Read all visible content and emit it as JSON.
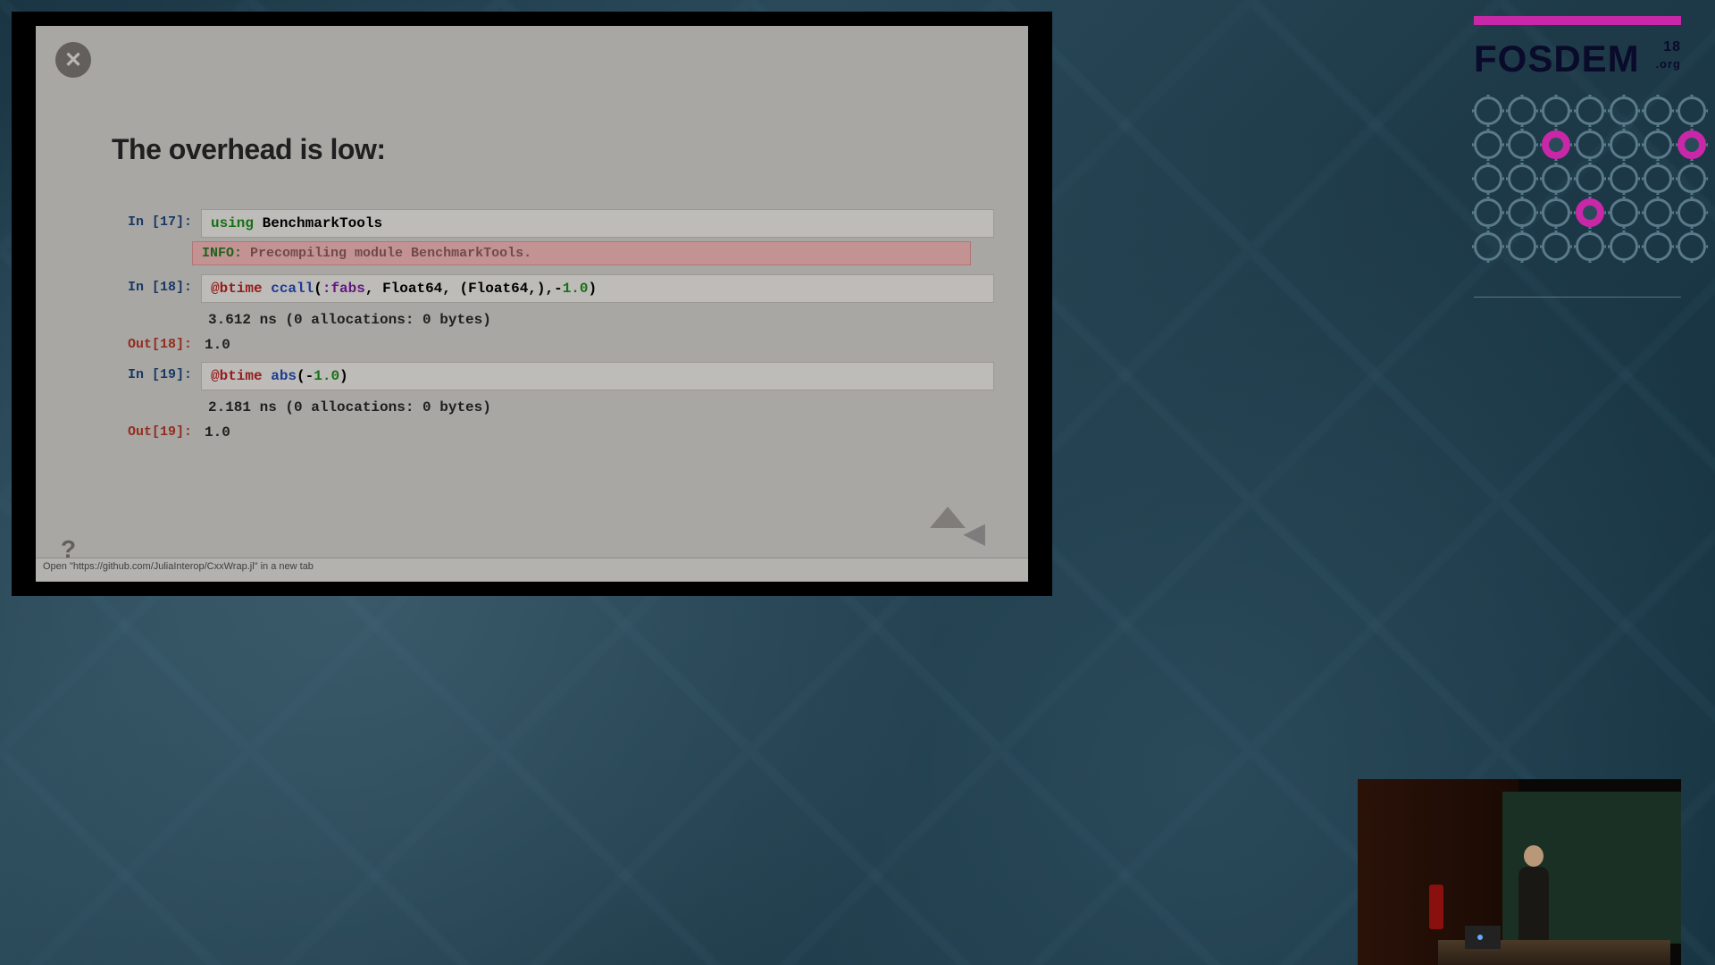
{
  "slide": {
    "title": "The overhead is low:",
    "status_bar": "Open \"https://github.com/JuliaInterop/CxxWrap.jl\" in a new tab",
    "help_symbol": "?",
    "close_symbol": "✕"
  },
  "cells": {
    "in17": {
      "prompt": "In [17]:",
      "code_html": "<span class='kw-green'>using</span> BenchmarkTools"
    },
    "info": {
      "label": "INFO:",
      "text": "Precompiling module BenchmarkTools."
    },
    "in18": {
      "prompt": "In [18]:",
      "code_html": "<span class='kw-red'>@btime</span> <span class='kw-blue'>ccall</span>(<span class='kw-purple'>:fabs</span>, Float64, (Float64,),-<span class='kw-green'>1.0</span>)"
    },
    "stdout18": "  3.612 ns (0 allocations: 0 bytes)",
    "out18": {
      "prompt": "Out[18]:",
      "value": "1.0"
    },
    "in19": {
      "prompt": "In [19]:",
      "code_html": "<span class='kw-red'>@btime</span> <span class='kw-blue'>abs</span>(-<span class='kw-green'>1.0</span>)"
    },
    "stdout19": "  2.181 ns (0 allocations: 0 bytes)",
    "out19": {
      "prompt": "Out[19]:",
      "value": "1.0"
    }
  },
  "branding": {
    "name": "FOSDEM",
    "year": "18",
    "domain": ".org"
  }
}
